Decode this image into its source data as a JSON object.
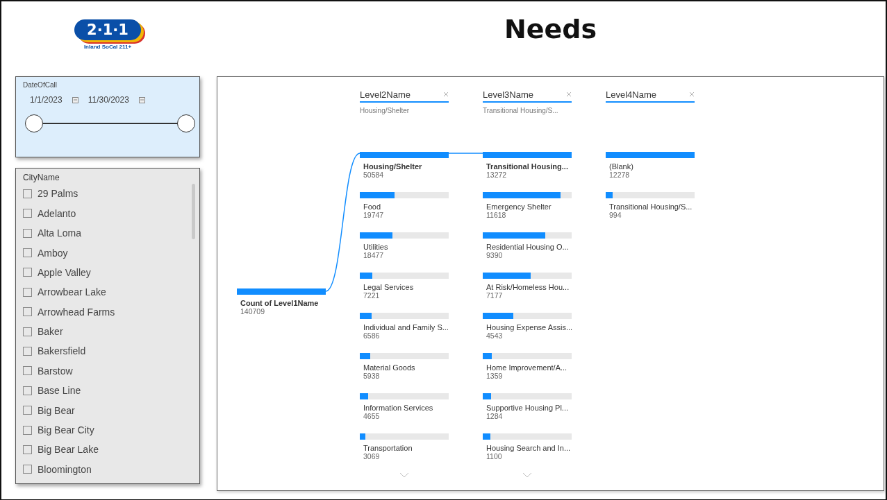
{
  "logo": {
    "mark": "2·1·1",
    "caption": "Inland SoCal 211+"
  },
  "title": "Needs",
  "date_slicer": {
    "label": "DateOfCall",
    "start": "1/1/2023",
    "end": "11/30/2023",
    "handles": [
      {
        "level": 0
      },
      {
        "level": 1
      }
    ]
  },
  "city_slicer": {
    "label": "CityName",
    "items": [
      {
        "label": "29 Palms",
        "checked": false
      },
      {
        "label": "Adelanto",
        "checked": false
      },
      {
        "label": "Alta Loma",
        "checked": false
      },
      {
        "label": "Amboy",
        "checked": false
      },
      {
        "label": "Apple Valley",
        "checked": false
      },
      {
        "label": "Arrowbear Lake",
        "checked": false
      },
      {
        "label": "Arrowhead Farms",
        "checked": false
      },
      {
        "label": "Baker",
        "checked": false
      },
      {
        "label": "Bakersfield",
        "checked": false
      },
      {
        "label": "Barstow",
        "checked": false
      },
      {
        "label": "Base Line",
        "checked": false
      },
      {
        "label": "Big Bear",
        "checked": false
      },
      {
        "label": "Big Bear City",
        "checked": false
      },
      {
        "label": "Big Bear Lake",
        "checked": false
      },
      {
        "label": "Bloomington",
        "checked": false
      }
    ]
  },
  "tree": {
    "root": {
      "label": "Count of Level1Name",
      "value": "140709",
      "level": 1
    },
    "columns": [
      {
        "title": "Level2Name",
        "filter": "Housing/Shelter",
        "more": true,
        "items": [
          {
            "label": "Housing/Shelter",
            "value": "50584",
            "level": 1,
            "selected": true
          },
          {
            "label": "Food",
            "value": "19747",
            "level": 0.39,
            "selected": false
          },
          {
            "label": "Utilities",
            "value": "18477",
            "level": 0.365,
            "selected": false
          },
          {
            "label": "Legal Services",
            "value": "7221",
            "level": 0.143,
            "selected": false
          },
          {
            "label": "Individual and Family S...",
            "value": "6586",
            "level": 0.13,
            "selected": false
          },
          {
            "label": "Material Goods",
            "value": "5938",
            "level": 0.117,
            "selected": false
          },
          {
            "label": "Information Services",
            "value": "4655",
            "level": 0.092,
            "selected": false
          },
          {
            "label": "Transportation",
            "value": "3069",
            "level": 0.061,
            "selected": false
          }
        ]
      },
      {
        "title": "Level3Name",
        "filter": "Transitional Housing/S...",
        "more": true,
        "items": [
          {
            "label": "Transitional Housing...",
            "value": "13272",
            "level": 1,
            "selected": true
          },
          {
            "label": "Emergency Shelter",
            "value": "11618",
            "level": 0.875,
            "selected": false
          },
          {
            "label": "Residential Housing O...",
            "value": "9390",
            "level": 0.707,
            "selected": false
          },
          {
            "label": "At Risk/Homeless Hou...",
            "value": "7177",
            "level": 0.541,
            "selected": false
          },
          {
            "label": "Housing Expense Assis...",
            "value": "4543",
            "level": 0.342,
            "selected": false
          },
          {
            "label": "Home Improvement/A...",
            "value": "1359",
            "level": 0.102,
            "selected": false
          },
          {
            "label": "Supportive Housing Pl...",
            "value": "1284",
            "level": 0.097,
            "selected": false
          },
          {
            "label": "Housing Search and In...",
            "value": "1100",
            "level": 0.083,
            "selected": false
          }
        ]
      },
      {
        "title": "Level4Name",
        "more": false,
        "items": [
          {
            "label": "(Blank)",
            "value": "12278",
            "level": 1,
            "selected": false
          },
          {
            "label": "Transitional Housing/S...",
            "value": "994",
            "level": 0.081,
            "selected": false
          }
        ]
      }
    ]
  }
}
